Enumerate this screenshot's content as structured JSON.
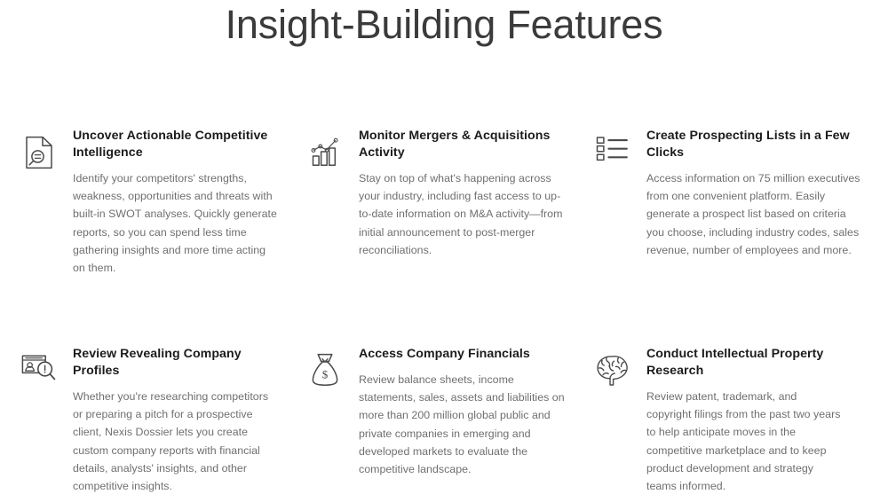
{
  "header": {
    "title": "Insight-Building Features"
  },
  "colors": {
    "background": "#ffffff",
    "title_text": "#3b3b3b",
    "heading_text": "#1c1c1c",
    "body_text": "#6f6f6f",
    "icon_stroke": "#4a4a4a"
  },
  "features": [
    {
      "icon": "document-search-icon",
      "title": "Uncover Actionable Competitive Intelligence",
      "text": "Identify your competitors' strengths, weakness, opportunities and threats with built-in SWOT analyses. Quickly generate reports, so you can spend less time gathering insights and more time acting on them."
    },
    {
      "icon": "bar-chart-trend-icon",
      "title": "Monitor Mergers & Acquisitions Activity",
      "text": "Stay on top of what's happening across your industry, including fast access to up-to-date information on M&A activity—from initial announcement to post-merger reconciliations."
    },
    {
      "icon": "checklist-icon",
      "title": "Create Prospecting Lists in a Few Clicks",
      "text": "Access information on 75 million executives from one convenient platform. Easily generate a prospect list based on criteria you choose, including industry codes, sales revenue, number of employees and more."
    },
    {
      "icon": "profile-card-search-icon",
      "title": "Review Revealing Company Profiles",
      "text": "Whether you're researching competitors or preparing a pitch for a prospective client, Nexis Dossier lets you create custom company reports with financial details, analysts' insights, and other competitive insights."
    },
    {
      "icon": "money-bag-icon",
      "title": "Access Company Financials",
      "text": "Review balance sheets, income statements, sales, assets and liabilities on more than 200 million global public and private companies in emerging and developed markets to evaluate the competitive landscape."
    },
    {
      "icon": "brain-icon",
      "title": "Conduct Intellectual Property Research",
      "text": "Review patent, trademark, and copyright filings from the past two years to help anticipate moves in the competitive marketplace and to keep product development and strategy teams informed."
    }
  ]
}
